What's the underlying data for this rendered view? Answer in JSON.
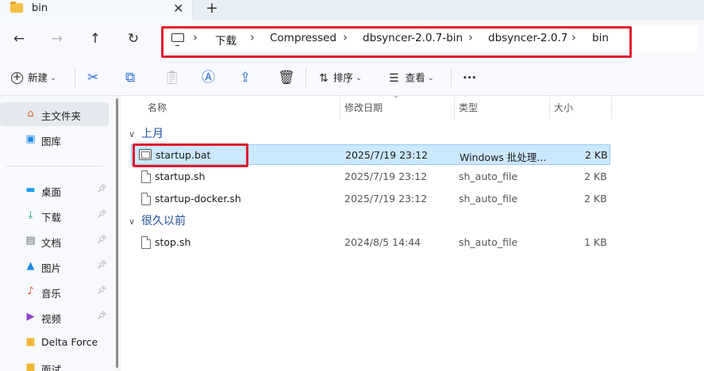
{
  "tab": {
    "title": "bin",
    "close": "✕",
    "new": "+"
  },
  "nav": {
    "back": "←",
    "forward": "→",
    "up": "↑",
    "refresh": "↻"
  },
  "breadcrumbs": [
    {
      "label": "下载"
    },
    {
      "label": "Compressed"
    },
    {
      "label": "dbsyncer-2.0.7-bin"
    },
    {
      "label": "dbsyncer-2.0.7"
    },
    {
      "label": "bin"
    }
  ],
  "commands": {
    "new": "新建",
    "sort": "排序",
    "view": "查看",
    "more": "···"
  },
  "sidebar": {
    "items": [
      {
        "label": "主文件夹"
      },
      {
        "label": "图库"
      },
      {
        "label": "桌面"
      },
      {
        "label": "下载"
      },
      {
        "label": "文档"
      },
      {
        "label": "图片"
      },
      {
        "label": "音乐"
      },
      {
        "label": "视频"
      },
      {
        "label": "Delta Force"
      },
      {
        "label": "面试"
      }
    ]
  },
  "columns": {
    "name": "名称",
    "modified": "修改日期",
    "type": "类型",
    "size": "大小"
  },
  "groups": [
    {
      "label": "上月",
      "files": [
        {
          "name": "startup.bat",
          "modified": "2025/7/19 23:12",
          "type": "Windows 批处理...",
          "size": "2 KB"
        },
        {
          "name": "startup.sh",
          "modified": "2025/7/19 23:12",
          "type": "sh_auto_file",
          "size": "2 KB"
        },
        {
          "name": "startup-docker.sh",
          "modified": "2025/7/19 23:12",
          "type": "sh_auto_file",
          "size": "2 KB"
        }
      ]
    },
    {
      "label": "很久以前",
      "files": [
        {
          "name": "stop.sh",
          "modified": "2024/8/5 14:44",
          "type": "sh_auto_file",
          "size": "1 KB"
        }
      ]
    }
  ]
}
